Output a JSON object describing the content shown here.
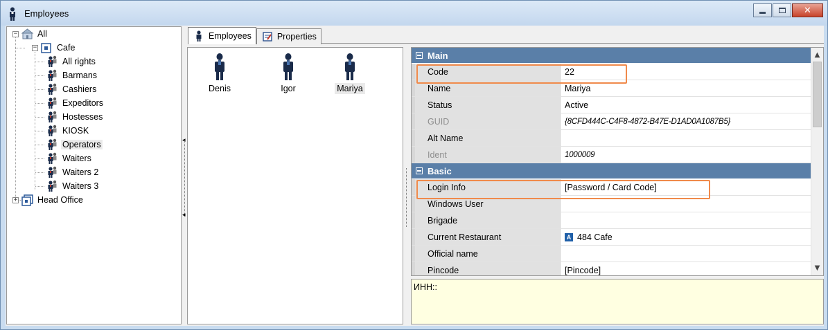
{
  "window": {
    "title": "Employees"
  },
  "tree": {
    "root": "All",
    "cafe": "Cafe",
    "groups": [
      "All rights",
      "Barmans",
      "Cashiers",
      "Expeditors",
      "Hostesses",
      "KIOSK",
      "Operators",
      "Waiters",
      "Waiters 2",
      "Waiters 3"
    ],
    "selected_group": "Operators",
    "head_office": "Head Office"
  },
  "tabs": [
    {
      "label": "Employees",
      "active": true
    },
    {
      "label": "Properties",
      "active": false
    }
  ],
  "employees": [
    "Denis",
    "Igor",
    "Mariya"
  ],
  "selected_employee": "Mariya",
  "property_grid": {
    "categories": {
      "main": {
        "label": "Main",
        "rows": [
          {
            "name": "Code",
            "value": "22"
          },
          {
            "name": "Name",
            "value": "Mariya"
          },
          {
            "name": "Status",
            "value": "Active"
          },
          {
            "name": "GUID",
            "value": "{8CFD444C-C4F8-4872-B47E-D1AD0A1087B5}"
          },
          {
            "name": "Alt Name",
            "value": ""
          },
          {
            "name": "Ident",
            "value": "1000009"
          }
        ]
      },
      "basic": {
        "label": "Basic",
        "rows": [
          {
            "name": "Login Info",
            "value": "[Password / Card Code]"
          },
          {
            "name": "Windows User",
            "value": ""
          },
          {
            "name": "Brigade",
            "value": ""
          },
          {
            "name": "Current Restaurant",
            "value": "484 Cafe"
          },
          {
            "name": "Official name",
            "value": ""
          },
          {
            "name": "Pincode",
            "value": "[Pincode]"
          }
        ]
      }
    },
    "restaurant_badge": "A"
  },
  "description": "ИНН::",
  "colors": {
    "category_header": "#5a7fa8",
    "highlight": "#f08a4b",
    "description_bg": "#ffffe1"
  }
}
